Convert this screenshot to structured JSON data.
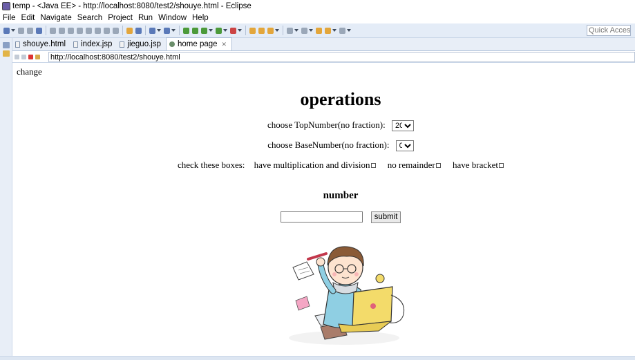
{
  "window": {
    "title": "temp - <Java EE> - http://localhost:8080/test2/shouye.html - Eclipse"
  },
  "menubar": {
    "items": [
      "File",
      "Edit",
      "Navigate",
      "Search",
      "Project",
      "Run",
      "Window",
      "Help"
    ]
  },
  "toolbar": {
    "quick_access_placeholder": "Quick Access"
  },
  "tabs": [
    {
      "label": "shouye.html",
      "active": false
    },
    {
      "label": "index.jsp",
      "active": false
    },
    {
      "label": "jieguo.jsp",
      "active": false
    },
    {
      "label": "home page",
      "active": true
    }
  ],
  "browser": {
    "url": "http://localhost:8080/test2/shouye.html"
  },
  "page": {
    "change_link": "change",
    "heading": "operations",
    "top_number": {
      "label": "choose TopNumber(no fraction):",
      "selected": "20"
    },
    "base_number": {
      "label": "choose BaseNumber(no fraction):",
      "selected": "0"
    },
    "checkboxes": {
      "intro": "check these boxes:",
      "options": [
        "have multiplication and division",
        "no remainder",
        "have bracket"
      ]
    },
    "number_heading": "number",
    "submit_label": "submit"
  }
}
